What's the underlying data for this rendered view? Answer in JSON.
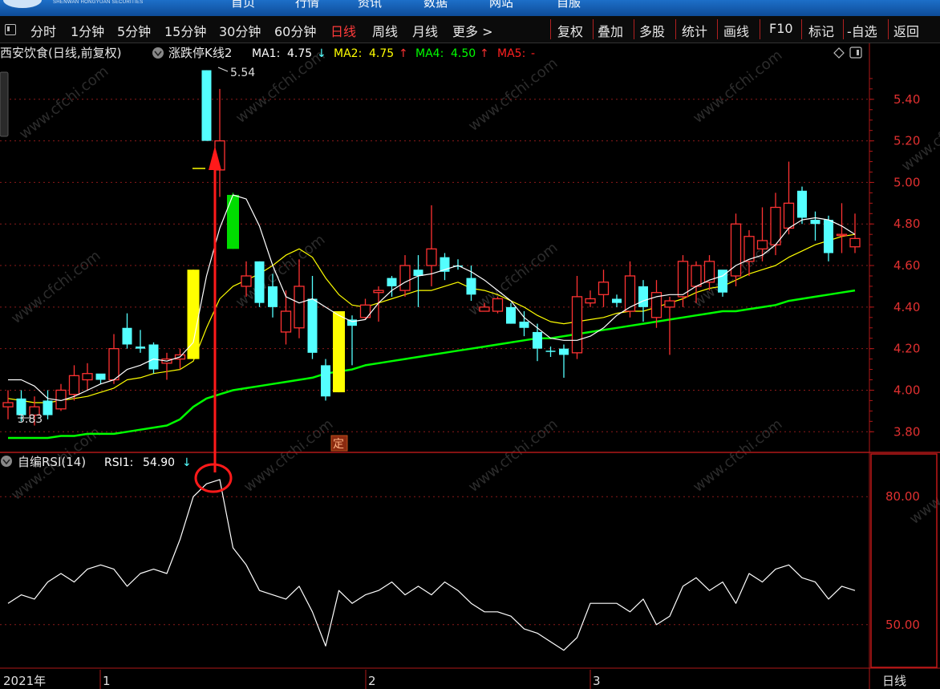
{
  "topbar": {
    "brand": "SHENWAN HONGYUAN SECURITIES",
    "nav": [
      "首页",
      "行情",
      "资讯",
      "数据",
      "网站",
      "自服"
    ]
  },
  "toolbar": {
    "periods": [
      "分时",
      "1分钟",
      "5分钟",
      "15分钟",
      "30分钟",
      "60分钟",
      "日线",
      "周线",
      "月线",
      "更多"
    ],
    "active_period": "日线",
    "more_arrow": ">",
    "actions": [
      "复权",
      "叠加",
      "多股",
      "统计",
      "画线",
      "F10",
      "标记",
      "-自选",
      "返回"
    ]
  },
  "main_panel": {
    "stock_label": "西安饮食(日线,前复权)",
    "indicator_name": "涨跌停K线2",
    "ma": [
      {
        "label": "MA1:",
        "value": "4.75",
        "arrow": "↓",
        "color": "#ffffff"
      },
      {
        "label": "MA2:",
        "value": "4.75",
        "arrow": "↑",
        "color": "#ffff00"
      },
      {
        "label": "MA4:",
        "value": "4.50",
        "arrow": "↑",
        "color": "#00ff00"
      },
      {
        "label": "MA5:",
        "value": "-",
        "arrow": "",
        "color": "#ff2020"
      }
    ],
    "high_marker": "5.54",
    "low_marker": "3.83",
    "ding_badge": "定",
    "y_ticks": [
      "5.40",
      "5.20",
      "5.00",
      "4.80",
      "4.60",
      "4.40",
      "4.20",
      "4.00",
      "3.80"
    ]
  },
  "rsi_panel": {
    "title": "自编RSI(14)",
    "rsi_label": "RSI1:",
    "rsi_value": "54.90",
    "rsi_arrow": "↓",
    "y_ticks": [
      "80.00",
      "50.00"
    ]
  },
  "x_axis": {
    "labels": [
      "2021年",
      "1",
      "2",
      "3"
    ],
    "period_tag": "日线"
  },
  "watermark": "www.cfchi.com",
  "colors": {
    "up": "#ff3232",
    "down": "#54ffff",
    "limit_up": "#ffff00",
    "limit_down": "#00dd00",
    "ma1": "#ffffff",
    "ma2": "#ffff00",
    "ma4": "#00ff00",
    "grid": "#8b1a1a",
    "axis": "#b01818"
  },
  "chart_data": {
    "type": "candlestick",
    "price_range": [
      3.72,
      5.6
    ],
    "candles": [
      {
        "o": 3.92,
        "h": 4.0,
        "l": 3.86,
        "c": 3.94,
        "kind": "up"
      },
      {
        "o": 3.96,
        "h": 4.0,
        "l": 3.85,
        "c": 3.88,
        "kind": "down"
      },
      {
        "o": 3.88,
        "h": 3.97,
        "l": 3.83,
        "c": 3.92,
        "kind": "up"
      },
      {
        "o": 3.95,
        "h": 4.0,
        "l": 3.86,
        "c": 3.88,
        "kind": "down"
      },
      {
        "o": 3.91,
        "h": 4.03,
        "l": 3.9,
        "c": 4.0,
        "kind": "up"
      },
      {
        "o": 3.98,
        "h": 4.12,
        "l": 3.95,
        "c": 4.07,
        "kind": "up"
      },
      {
        "o": 4.05,
        "h": 4.13,
        "l": 4.0,
        "c": 4.08,
        "kind": "up"
      },
      {
        "o": 4.08,
        "h": 4.07,
        "l": 4.03,
        "c": 4.05,
        "kind": "down"
      },
      {
        "o": 4.05,
        "h": 4.27,
        "l": 4.03,
        "c": 4.2,
        "kind": "up"
      },
      {
        "o": 4.3,
        "h": 4.37,
        "l": 4.2,
        "c": 4.22,
        "kind": "down"
      },
      {
        "o": 4.21,
        "h": 4.29,
        "l": 4.18,
        "c": 4.2,
        "kind": "down"
      },
      {
        "o": 4.22,
        "h": 4.23,
        "l": 4.08,
        "c": 4.1,
        "kind": "down"
      },
      {
        "o": 4.13,
        "h": 4.18,
        "l": 4.05,
        "c": 4.15,
        "kind": "up"
      },
      {
        "o": 4.15,
        "h": 4.2,
        "l": 4.1,
        "c": 4.17,
        "kind": "up"
      },
      {
        "o": 4.15,
        "h": 4.58,
        "l": 4.15,
        "c": 4.58,
        "kind": "limit_up"
      },
      {
        "o": 5.2,
        "h": 5.54,
        "l": 5.2,
        "c": 5.54,
        "kind": "down"
      },
      {
        "o": 5.06,
        "h": 5.45,
        "l": 4.93,
        "c": 5.2,
        "kind": "up"
      },
      {
        "o": 4.94,
        "h": 4.95,
        "l": 4.68,
        "c": 4.68,
        "kind": "limit_down"
      },
      {
        "o": 4.5,
        "h": 4.62,
        "l": 4.45,
        "c": 4.55,
        "kind": "up"
      },
      {
        "o": 4.62,
        "h": 4.62,
        "l": 4.4,
        "c": 4.42,
        "kind": "down"
      },
      {
        "o": 4.5,
        "h": 4.56,
        "l": 4.35,
        "c": 4.4,
        "kind": "down"
      },
      {
        "o": 4.28,
        "h": 4.48,
        "l": 4.22,
        "c": 4.38,
        "kind": "up"
      },
      {
        "o": 4.3,
        "h": 4.63,
        "l": 4.25,
        "c": 4.5,
        "kind": "up"
      },
      {
        "o": 4.44,
        "h": 4.55,
        "l": 4.15,
        "c": 4.18,
        "kind": "down"
      },
      {
        "o": 4.12,
        "h": 4.15,
        "l": 3.95,
        "c": 3.97,
        "kind": "down"
      },
      {
        "o": 3.99,
        "h": 4.38,
        "l": 3.99,
        "c": 4.38,
        "kind": "limit_up"
      },
      {
        "o": 4.34,
        "h": 4.36,
        "l": 4.12,
        "c": 4.31,
        "kind": "down"
      },
      {
        "o": 4.35,
        "h": 4.44,
        "l": 4.34,
        "c": 4.41,
        "kind": "up"
      },
      {
        "o": 4.47,
        "h": 4.5,
        "l": 4.33,
        "c": 4.48,
        "kind": "up"
      },
      {
        "o": 4.54,
        "h": 4.55,
        "l": 4.45,
        "c": 4.5,
        "kind": "down"
      },
      {
        "o": 4.48,
        "h": 4.65,
        "l": 4.45,
        "c": 4.6,
        "kind": "up"
      },
      {
        "o": 4.58,
        "h": 4.65,
        "l": 4.4,
        "c": 4.55,
        "kind": "down"
      },
      {
        "o": 4.6,
        "h": 4.89,
        "l": 4.5,
        "c": 4.68,
        "kind": "up"
      },
      {
        "o": 4.64,
        "h": 4.66,
        "l": 4.53,
        "c": 4.57,
        "kind": "down"
      },
      {
        "o": 4.6,
        "h": 4.63,
        "l": 4.58,
        "c": 4.6,
        "kind": "down"
      },
      {
        "o": 4.54,
        "h": 4.6,
        "l": 4.43,
        "c": 4.46,
        "kind": "down"
      },
      {
        "o": 4.4,
        "h": 4.42,
        "l": 4.38,
        "c": 4.38,
        "kind": "up"
      },
      {
        "o": 4.38,
        "h": 4.45,
        "l": 4.37,
        "c": 4.44,
        "kind": "up"
      },
      {
        "o": 4.4,
        "h": 4.42,
        "l": 4.32,
        "c": 4.32,
        "kind": "down"
      },
      {
        "o": 4.33,
        "h": 4.38,
        "l": 4.26,
        "c": 4.3,
        "kind": "down"
      },
      {
        "o": 4.28,
        "h": 4.32,
        "l": 4.14,
        "c": 4.2,
        "kind": "down"
      },
      {
        "o": 4.19,
        "h": 4.21,
        "l": 4.16,
        "c": 4.19,
        "kind": "down"
      },
      {
        "o": 4.2,
        "h": 4.22,
        "l": 4.06,
        "c": 4.17,
        "kind": "down"
      },
      {
        "o": 4.18,
        "h": 4.55,
        "l": 4.15,
        "c": 4.45,
        "kind": "up"
      },
      {
        "o": 4.42,
        "h": 4.48,
        "l": 4.4,
        "c": 4.44,
        "kind": "up"
      },
      {
        "o": 4.46,
        "h": 4.58,
        "l": 4.4,
        "c": 4.52,
        "kind": "up"
      },
      {
        "o": 4.44,
        "h": 4.46,
        "l": 4.4,
        "c": 4.42,
        "kind": "down"
      },
      {
        "o": 4.38,
        "h": 4.62,
        "l": 4.35,
        "c": 4.55,
        "kind": "up"
      },
      {
        "o": 4.5,
        "h": 4.53,
        "l": 4.33,
        "c": 4.4,
        "kind": "down"
      },
      {
        "o": 4.35,
        "h": 4.53,
        "l": 4.3,
        "c": 4.47,
        "kind": "up"
      },
      {
        "o": 4.4,
        "h": 4.45,
        "l": 4.17,
        "c": 4.43,
        "kind": "up"
      },
      {
        "o": 4.45,
        "h": 4.65,
        "l": 4.4,
        "c": 4.62,
        "kind": "up"
      },
      {
        "o": 4.5,
        "h": 4.62,
        "l": 4.42,
        "c": 4.6,
        "kind": "up"
      },
      {
        "o": 4.52,
        "h": 4.65,
        "l": 4.48,
        "c": 4.62,
        "kind": "up"
      },
      {
        "o": 4.58,
        "h": 4.5,
        "l": 4.45,
        "c": 4.47,
        "kind": "down"
      },
      {
        "o": 4.55,
        "h": 4.85,
        "l": 4.5,
        "c": 4.8,
        "kind": "up"
      },
      {
        "o": 4.62,
        "h": 4.77,
        "l": 4.55,
        "c": 4.74,
        "kind": "up"
      },
      {
        "o": 4.68,
        "h": 4.88,
        "l": 4.62,
        "c": 4.72,
        "kind": "up"
      },
      {
        "o": 4.7,
        "h": 4.95,
        "l": 4.65,
        "c": 4.88,
        "kind": "up"
      },
      {
        "o": 4.78,
        "h": 5.1,
        "l": 4.75,
        "c": 4.9,
        "kind": "up"
      },
      {
        "o": 4.96,
        "h": 4.98,
        "l": 4.8,
        "c": 4.83,
        "kind": "down"
      },
      {
        "o": 4.82,
        "h": 4.86,
        "l": 4.72,
        "c": 4.8,
        "kind": "down"
      },
      {
        "o": 4.82,
        "h": 4.84,
        "l": 4.62,
        "c": 4.66,
        "kind": "down"
      },
      {
        "o": 4.75,
        "h": 4.9,
        "l": 4.66,
        "c": 4.75,
        "kind": "up"
      },
      {
        "o": 4.73,
        "h": 4.85,
        "l": 4.66,
        "c": 4.69,
        "kind": "up"
      }
    ],
    "ma1": [
      4.05,
      4.05,
      4.02,
      3.96,
      3.95,
      3.97,
      4.0,
      4.03,
      4.05,
      4.1,
      4.12,
      4.15,
      4.14,
      4.16,
      4.23,
      4.55,
      4.78,
      4.94,
      4.92,
      4.79,
      4.6,
      4.45,
      4.42,
      4.44,
      4.4,
      4.36,
      4.33,
      4.34,
      4.42,
      4.48,
      4.52,
      4.55,
      4.56,
      4.58,
      4.6,
      4.57,
      4.53,
      4.48,
      4.43,
      4.35,
      4.3,
      4.25,
      4.24,
      4.24,
      4.26,
      4.3,
      4.36,
      4.4,
      4.43,
      4.45,
      4.46,
      4.46,
      4.5,
      4.53,
      4.55,
      4.6,
      4.63,
      4.65,
      4.7,
      4.78,
      4.82,
      4.83,
      4.82,
      4.79,
      4.75
    ],
    "ma2": [
      3.96,
      3.95,
      3.94,
      3.94,
      3.95,
      3.96,
      3.97,
      3.99,
      4.01,
      4.05,
      4.06,
      4.08,
      4.09,
      4.1,
      4.14,
      4.3,
      4.44,
      4.5,
      4.53,
      4.56,
      4.6,
      4.65,
      4.68,
      4.64,
      4.54,
      4.46,
      4.41,
      4.4,
      4.42,
      4.44,
      4.46,
      4.48,
      4.48,
      4.5,
      4.52,
      4.49,
      4.48,
      4.46,
      4.43,
      4.4,
      4.36,
      4.33,
      4.32,
      4.33,
      4.34,
      4.35,
      4.37,
      4.38,
      4.38,
      4.4,
      4.42,
      4.44,
      4.47,
      4.49,
      4.5,
      4.53,
      4.56,
      4.58,
      4.6,
      4.64,
      4.67,
      4.7,
      4.72,
      4.74,
      4.75
    ],
    "ma4": [
      3.77,
      3.77,
      3.77,
      3.77,
      3.78,
      3.78,
      3.79,
      3.79,
      3.79,
      3.8,
      3.81,
      3.82,
      3.83,
      3.86,
      3.92,
      3.96,
      3.98,
      4.0,
      4.01,
      4.02,
      4.03,
      4.04,
      4.05,
      4.06,
      4.08,
      4.09,
      4.1,
      4.12,
      4.13,
      4.14,
      4.15,
      4.16,
      4.17,
      4.18,
      4.19,
      4.2,
      4.21,
      4.22,
      4.23,
      4.24,
      4.25,
      4.25,
      4.26,
      4.27,
      4.28,
      4.29,
      4.3,
      4.31,
      4.32,
      4.33,
      4.34,
      4.35,
      4.36,
      4.37,
      4.38,
      4.38,
      4.39,
      4.4,
      4.41,
      4.43,
      4.44,
      4.45,
      4.46,
      4.47,
      4.48
    ],
    "rsi": [
      55,
      57,
      56,
      60,
      62,
      60,
      63,
      64,
      63,
      59,
      62,
      63,
      62,
      70,
      80,
      83,
      84,
      68,
      64,
      58,
      57,
      56,
      59,
      53,
      45,
      58,
      55,
      57,
      58,
      60,
      57,
      59,
      57,
      60,
      58,
      55,
      53,
      53,
      52,
      49,
      48,
      46,
      44,
      47,
      55,
      55,
      55,
      53,
      56,
      50,
      52,
      59,
      61,
      58,
      60,
      55,
      62,
      60,
      63,
      64,
      61,
      60,
      56,
      59,
      58
    ],
    "rsi_range": [
      40,
      90
    ]
  }
}
